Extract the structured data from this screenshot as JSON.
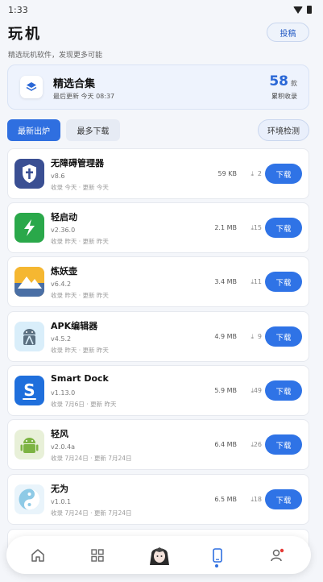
{
  "status_bar": {
    "time": "1:33"
  },
  "header": {
    "title": "玩机",
    "subtitle": "精选玩机软件，发现更多可能",
    "submit_label": "投稿"
  },
  "collection": {
    "title": "精选合集",
    "updated": "最后更新 今天 08:37",
    "count": "58",
    "count_unit": "款",
    "count_label": "累积收录"
  },
  "tabs": {
    "latest": "最新出炉",
    "most_downloaded": "最多下载"
  },
  "env_check_label": "环境检测",
  "download_label": "下载",
  "apps": [
    {
      "name": "无障碍管理器",
      "version": "v8.6",
      "dates": "收录 今天 · 更新 今天",
      "size": "59 KB",
      "downloads": "2",
      "icon": "shield-cross-icon",
      "icon_color": "#3a4f93"
    },
    {
      "name": "轻启动",
      "version": "v2.36.0",
      "dates": "收录 昨天 · 更新 昨天",
      "size": "2.1 MB",
      "downloads": "15",
      "icon": "lightning-icon",
      "icon_color": "#2aa84a"
    },
    {
      "name": "炼妖壶",
      "version": "v6.4.2",
      "dates": "收录 昨天 · 更新 昨天",
      "size": "3.4 MB",
      "downloads": "11",
      "icon": "mountain-icon",
      "icon_color": "#f0a020"
    },
    {
      "name": "APK编辑器",
      "version": "v4.5.2",
      "dates": "收录 昨天 · 更新 昨天",
      "size": "4.9 MB",
      "downloads": "9",
      "icon": "android-tools-icon",
      "icon_color": "#d9eefa"
    },
    {
      "name": "Smart Dock",
      "version": "v1.13.0",
      "dates": "收录 7月6日 · 更新 昨天",
      "size": "5.9 MB",
      "downloads": "49",
      "icon": "smart-dock-icon",
      "icon_color": "#1f6fdc"
    },
    {
      "name": "轻风",
      "version": "v2.0.4a",
      "dates": "收录 7月24日 · 更新 7月24日",
      "size": "6.4 MB",
      "downloads": "26",
      "icon": "android-robot-icon",
      "icon_color": "#7cb342"
    },
    {
      "name": "无为",
      "version": "v1.0.1",
      "dates": "收录 7月24日 · 更新 7月24日",
      "size": "6.5 MB",
      "downloads": "18",
      "icon": "yin-yang-icon",
      "icon_color": "#8ecae6"
    }
  ],
  "colors": {
    "accent": "#2f6fe0",
    "download_button": "#2f73e6",
    "background": "#f4f6fa"
  }
}
